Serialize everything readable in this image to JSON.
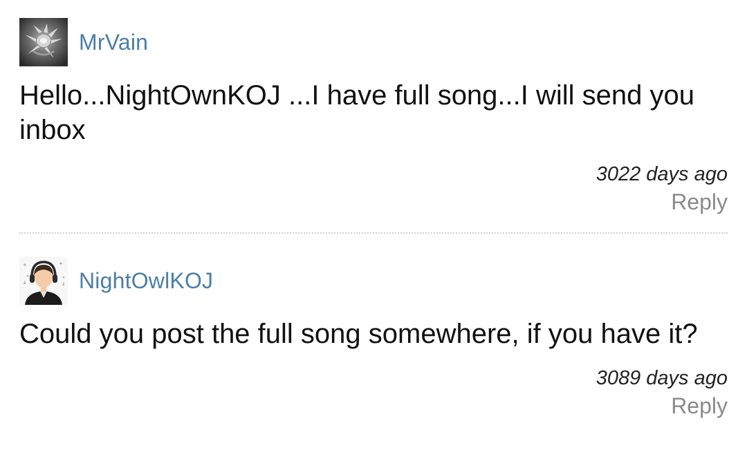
{
  "comments": [
    {
      "username": "MrVain",
      "avatar_icon": "spiky-creature-avatar",
      "text": "Hello...NightOwnKOJ ...I have full song...I will send you inbox",
      "timestamp": "3022 days ago",
      "reply_label": "Reply"
    },
    {
      "username": "NightOwlKOJ",
      "avatar_icon": "headphones-person-avatar",
      "text": "Could you post the full song somewhere, if you have it?",
      "timestamp": "3089 days ago",
      "reply_label": "Reply"
    }
  ],
  "colors": {
    "username": "#4a7fa7",
    "reply": "#8a8a8a",
    "divider": "#cfcfcf"
  }
}
